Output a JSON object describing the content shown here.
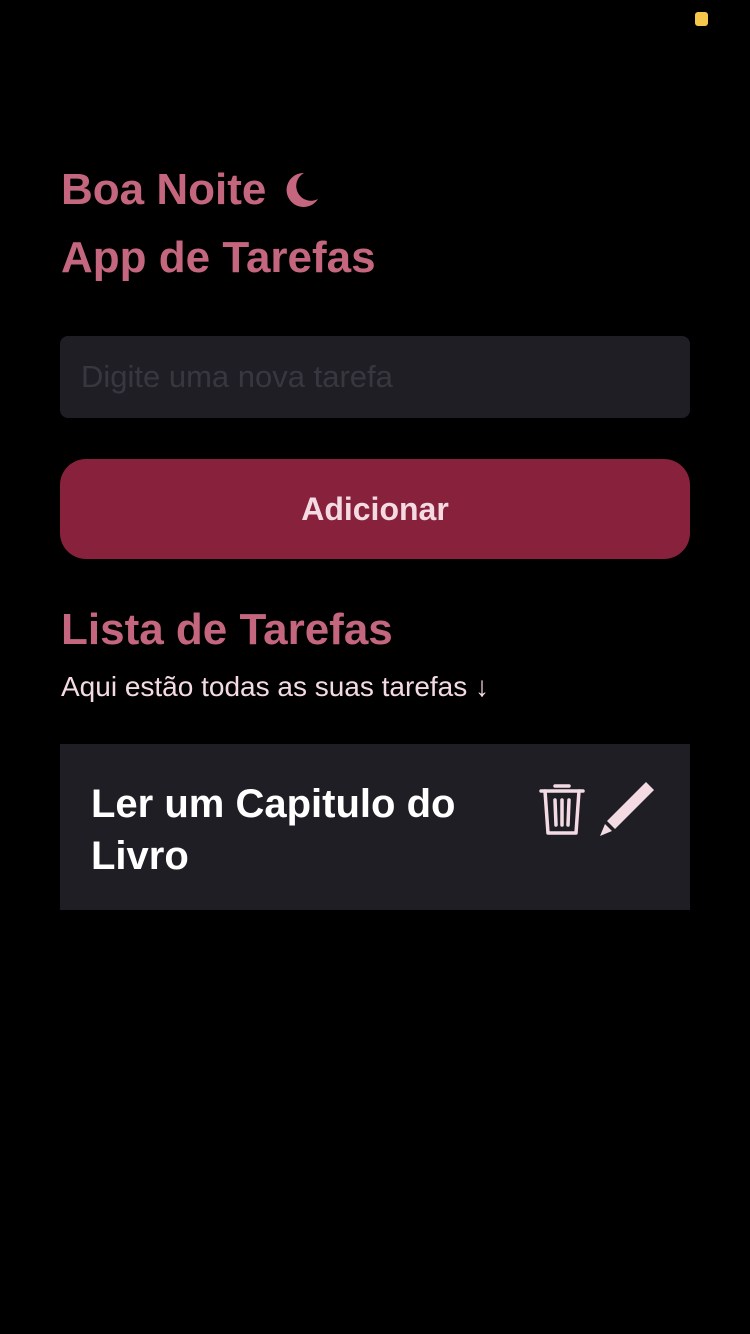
{
  "header": {
    "greeting": "Boa Noite",
    "greeting_icon": "moon-icon",
    "app_title": "App de Tarefas"
  },
  "form": {
    "input_value": "",
    "input_placeholder": "Digite uma nova tarefa",
    "add_button_label": "Adicionar"
  },
  "list": {
    "title": "Lista de Tarefas",
    "subtitle": "Aqui estão todas as suas tarefas ↓",
    "items": [
      {
        "text": "Ler um Capitulo do Livro",
        "delete_icon": "trash-icon",
        "edit_icon": "pencil-icon"
      }
    ]
  },
  "colors": {
    "background": "#000000",
    "accent": "#c4667e",
    "button": "#87213c",
    "button_text": "#f4dbe3",
    "card": "#1f1e25",
    "icon": "#f4dbe3",
    "status_indicator": "#f5c84c"
  }
}
